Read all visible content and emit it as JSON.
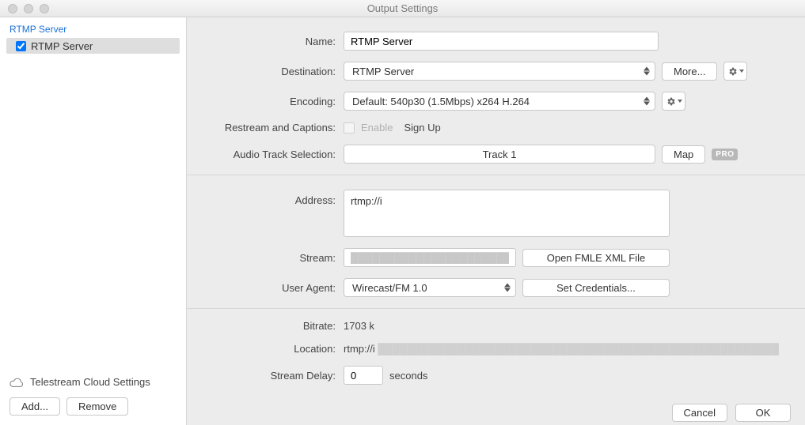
{
  "window": {
    "title": "Output Settings"
  },
  "sidebar": {
    "header": "RTMP Server",
    "items": [
      {
        "label": "RTMP Server",
        "checked": true
      }
    ],
    "cloud_settings_label": "Telestream Cloud Settings",
    "add_label": "Add...",
    "remove_label": "Remove"
  },
  "form": {
    "name": {
      "label": "Name:",
      "value": "RTMP Server"
    },
    "destination": {
      "label": "Destination:",
      "value": "RTMP Server",
      "more_label": "More..."
    },
    "encoding": {
      "label": "Encoding:",
      "value": "Default: 540p30 (1.5Mbps) x264 H.264"
    },
    "restream": {
      "label": "Restream and Captions:",
      "enable_label": "Enable",
      "signup_label": "Sign Up"
    },
    "audio_track": {
      "label": "Audio Track Selection:",
      "track_label": "Track 1",
      "map_label": "Map",
      "pro_label": "PRO"
    },
    "address": {
      "label": "Address:",
      "prefix": "rtmp://i"
    },
    "stream": {
      "label": "Stream:",
      "value": "",
      "open_fmle_label": "Open FMLE XML File"
    },
    "user_agent": {
      "label": "User Agent:",
      "value": "Wirecast/FM 1.0",
      "credentials_label": "Set Credentials..."
    },
    "bitrate": {
      "label": "Bitrate:",
      "value": "1703 k"
    },
    "location": {
      "label": "Location:",
      "prefix": "rtmp://i"
    },
    "delay": {
      "label": "Stream Delay:",
      "value": "0",
      "unit": "seconds"
    }
  },
  "buttons": {
    "cancel": "Cancel",
    "ok": "OK"
  }
}
